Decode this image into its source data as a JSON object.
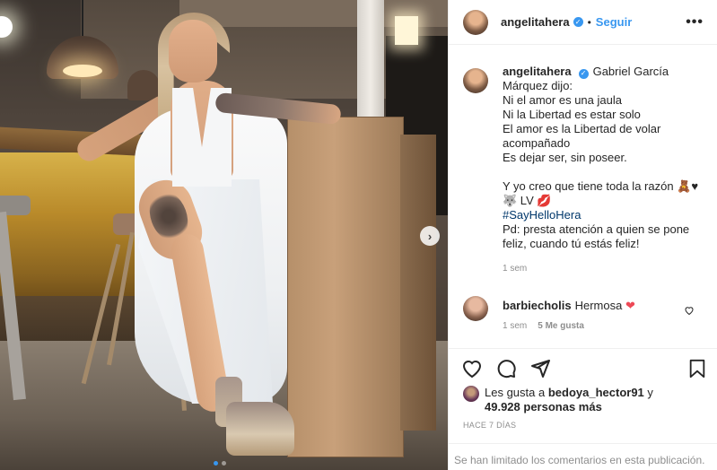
{
  "header": {
    "username": "angelitahera",
    "bullet": "•",
    "follow_label": "Seguir",
    "more_label": "•••"
  },
  "caption": {
    "username": "angelitahera",
    "lines": [
      "Gabriel García",
      "Márquez dijo:",
      "Ni el amor es una jaula",
      "Ni la Libertad es estar solo",
      "El amor es la Libertad de volar",
      "acompañado",
      "Es dejar ser, sin poseer.",
      "Y yo creo que tiene toda la razón 🧸♥",
      "🐺 LV 💋",
      "#SayHelloHera",
      "Pd: presta atención a quien se pone",
      "feliz, cuando tú estás feliz!"
    ],
    "time": "1 sem"
  },
  "comment": {
    "username": "barbiecholis",
    "text": "Hermosa",
    "heart": "❤",
    "time": "1 sem",
    "likes": "5 Me gusta"
  },
  "likes": {
    "prefix": "Les gusta a",
    "user": "bedoya_hector91",
    "conj": "y",
    "count": "49.928 personas más"
  },
  "post_age": "HACE 7 DÍAS",
  "comments_limited": "Se han limitado los comentarios en esta publicación.",
  "carousel": {
    "next_icon": "chevron-right",
    "slides": 2,
    "active_slide": 1
  },
  "colors": {
    "accent": "#3897f0",
    "text": "#262626",
    "muted": "#8e8e8e",
    "heart": "#ed4956",
    "hashtag": "#00376b"
  }
}
